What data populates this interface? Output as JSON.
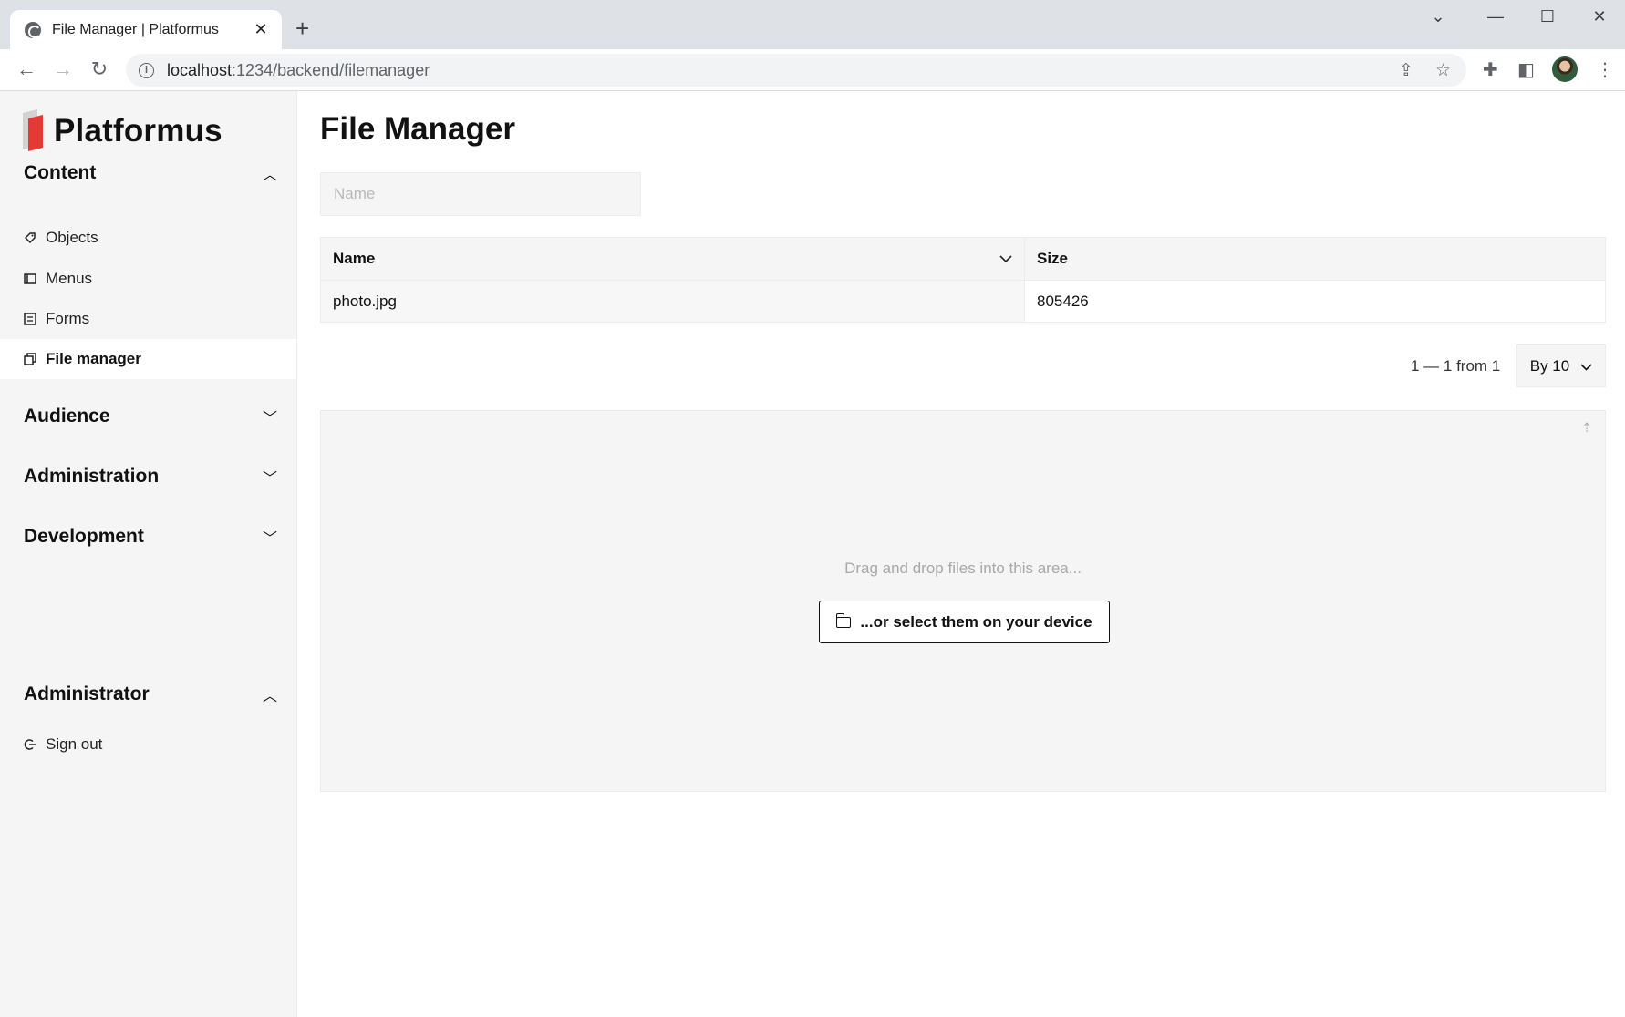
{
  "browser": {
    "tab_title": "File Manager | Platformus",
    "tab_close": "✕",
    "new_tab": "+",
    "url_host": "localhost",
    "url_rest": ":1234/backend/filemanager",
    "window_controls": {
      "tabsearch": "⌄",
      "minimize": "—",
      "maximize": "☐",
      "close": "✕"
    }
  },
  "sidebar": {
    "logo_text": "Platformus",
    "sections": {
      "content": {
        "title": "Content",
        "state": "expanded"
      },
      "audience": {
        "title": "Audience",
        "state": "collapsed"
      },
      "administration": {
        "title": "Administration",
        "state": "collapsed"
      },
      "development": {
        "title": "Development",
        "state": "collapsed"
      },
      "administrator": {
        "title": "Administrator",
        "state": "expanded"
      }
    },
    "content_items": [
      {
        "label": "Objects",
        "icon": "tag-icon"
      },
      {
        "label": "Menus",
        "icon": "menu-icon"
      },
      {
        "label": "Forms",
        "icon": "form-icon"
      },
      {
        "label": "File manager",
        "icon": "file-icon",
        "active": true
      }
    ],
    "administrator_items": [
      {
        "label": "Sign out",
        "icon": "sign-out-icon"
      }
    ]
  },
  "main": {
    "title": "File Manager",
    "filter": {
      "placeholder": "Name",
      "value": ""
    },
    "table": {
      "columns": [
        "Name",
        "Size"
      ],
      "sort_indicator": "chevron-down-icon",
      "rows": [
        {
          "name": "photo.jpg",
          "size": "805426"
        }
      ]
    },
    "pager": {
      "summary": "1 — 1 from 1",
      "page_size": "By 10"
    },
    "dropzone": {
      "text": "Drag and drop files into this area...",
      "button_label": "...or select them on your device"
    }
  },
  "colors": {
    "accent": "#e53935",
    "sidebar_bg": "#f5f5f5",
    "text": "#111111"
  }
}
